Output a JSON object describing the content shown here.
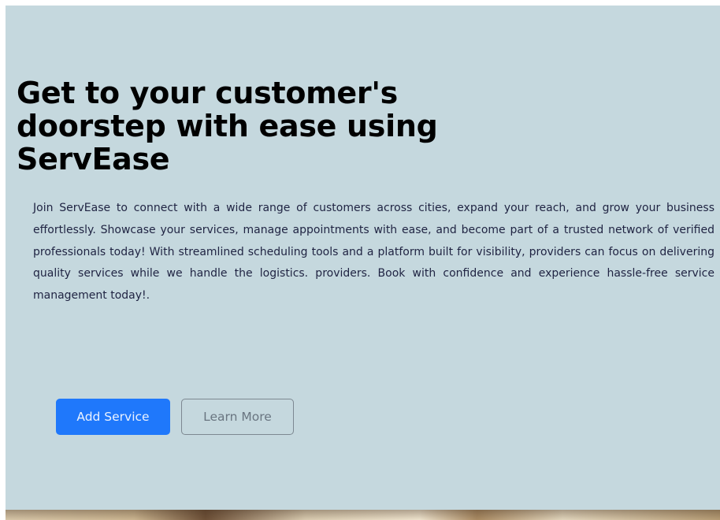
{
  "hero": {
    "title_line1": "Get to your customer's",
    "title_line2": "doorstep with ease using",
    "title_line3": "ServEase",
    "description": "Join ServEase to connect with a wide range of customers across cities, expand your reach, and grow your business effortlessly. Showcase your services, manage appointments with ease, and become part of a trusted network of verified professionals today! With streamlined scheduling tools and a platform built for visibility, providers can focus on delivering quality services while we handle the logistics. providers. Book with confidence and experience hassle-free service management today!.",
    "primary_button": "Add Service",
    "secondary_button": "Learn More"
  },
  "colors": {
    "background": "#c5d8de",
    "primary_button": "#1f78fb",
    "title_text": "#000000",
    "body_text": "#1f2342"
  }
}
